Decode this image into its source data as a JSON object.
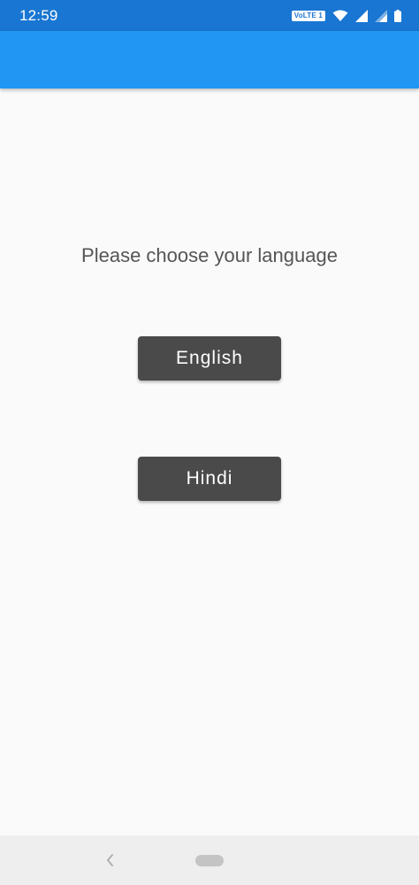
{
  "status_bar": {
    "time": "12:59",
    "volte_label": "VoLTE 1",
    "icons": [
      "wifi-icon",
      "signal-icon",
      "signal-icon",
      "battery-icon"
    ]
  },
  "colors": {
    "status_bar": "#1976d2",
    "app_bar": "#2196f3",
    "button": "#4a4a4a",
    "background": "#fafafa"
  },
  "content": {
    "prompt": "Please choose your language",
    "buttons": [
      {
        "label": "English"
      },
      {
        "label": "Hindi"
      }
    ]
  },
  "nav_bar": {
    "icons": [
      "back-icon",
      "home-pill-icon"
    ]
  }
}
